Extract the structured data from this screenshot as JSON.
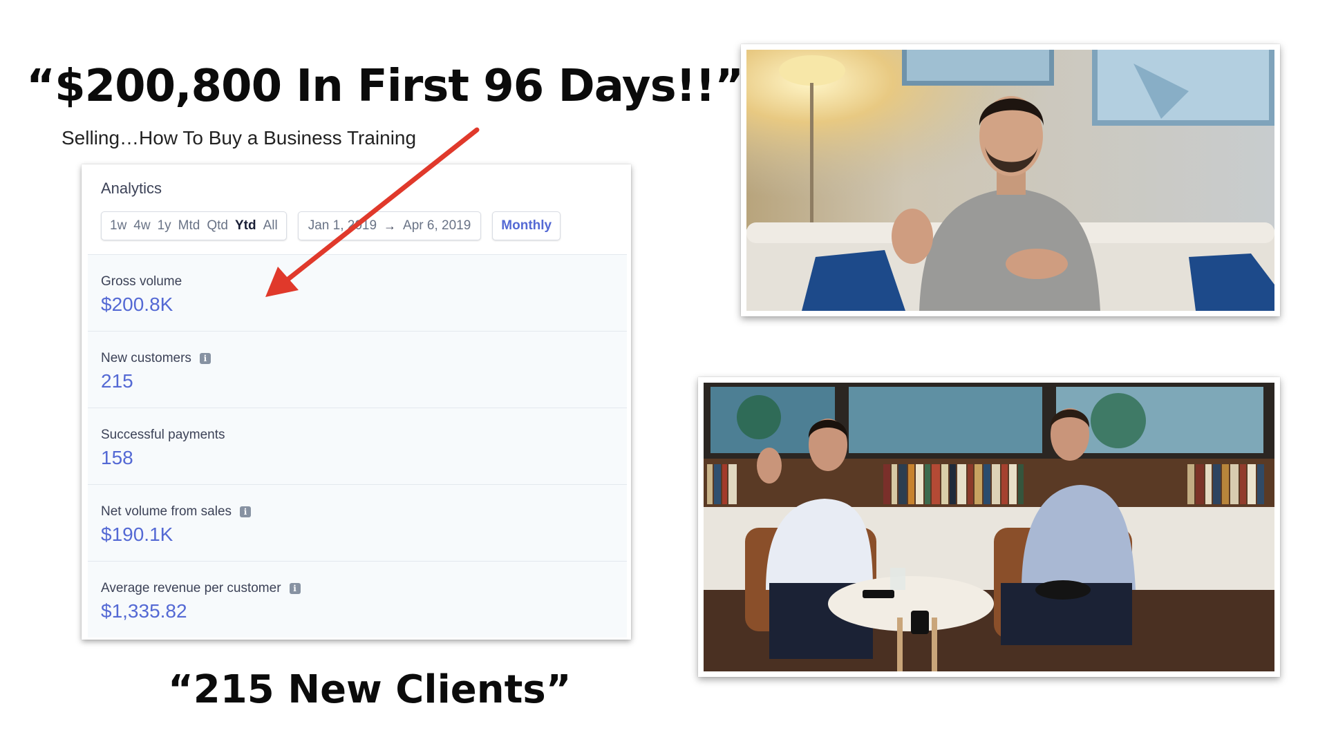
{
  "headline": "“$200,800 In First 96 Days!!”",
  "subline": "Selling…How To Buy a Business Training",
  "footer_quote": "“215 New Clients”",
  "analytics": {
    "title": "Analytics",
    "range_options": [
      "1w",
      "4w",
      "1y",
      "Mtd",
      "Qtd",
      "Ytd",
      "All"
    ],
    "active_range": "Ytd",
    "date_start": "Jan 1, 2019",
    "date_arrow": "→",
    "date_end": "Apr 6, 2019",
    "interval": "Monthly",
    "metrics": [
      {
        "label": "Gross volume",
        "value": "$200.8K",
        "info": false
      },
      {
        "label": "New customers",
        "value": "215",
        "info": true
      },
      {
        "label": "Successful payments",
        "value": "158",
        "info": false
      },
      {
        "label": "Net volume from sales",
        "value": "$190.1K",
        "info": true
      },
      {
        "label": "Average revenue per customer",
        "value": "$1,335.82",
        "info": true
      }
    ]
  },
  "colors": {
    "accent": "#5469d4",
    "arrow": "#e0392b",
    "metric_bg": "#f7fafc"
  },
  "icons": {
    "info": "info-icon",
    "pointer": "red-arrow-icon"
  }
}
